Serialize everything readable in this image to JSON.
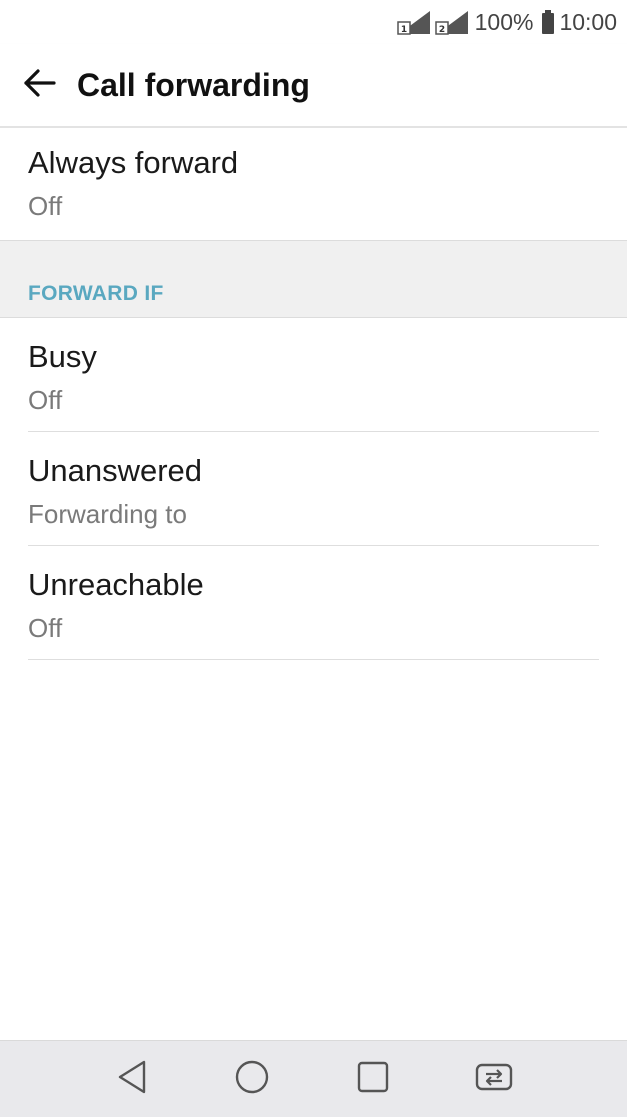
{
  "status_bar": {
    "battery_percent": "100%",
    "time": "10:00",
    "icons": [
      "sim1-signal-icon",
      "sim2-signal-icon",
      "battery-icon"
    ]
  },
  "app_bar": {
    "title": "Call forwarding",
    "back_icon": "back-arrow-icon"
  },
  "always_forward": {
    "title": "Always forward",
    "status": "Off"
  },
  "section": {
    "label": "FORWARD IF"
  },
  "conditions": [
    {
      "title": "Busy",
      "status": "Off"
    },
    {
      "title": "Unanswered",
      "status": "Forwarding to"
    },
    {
      "title": "Unreachable",
      "status": "Off"
    }
  ],
  "nav_bar": {
    "buttons": [
      "back-triangle-icon",
      "home-circle-icon",
      "recents-square-icon",
      "dual-window-icon"
    ]
  },
  "colors": {
    "section_label": "#5aa8c0",
    "section_bg": "#f0f0f0",
    "nav_bg": "#e9e9ec"
  }
}
